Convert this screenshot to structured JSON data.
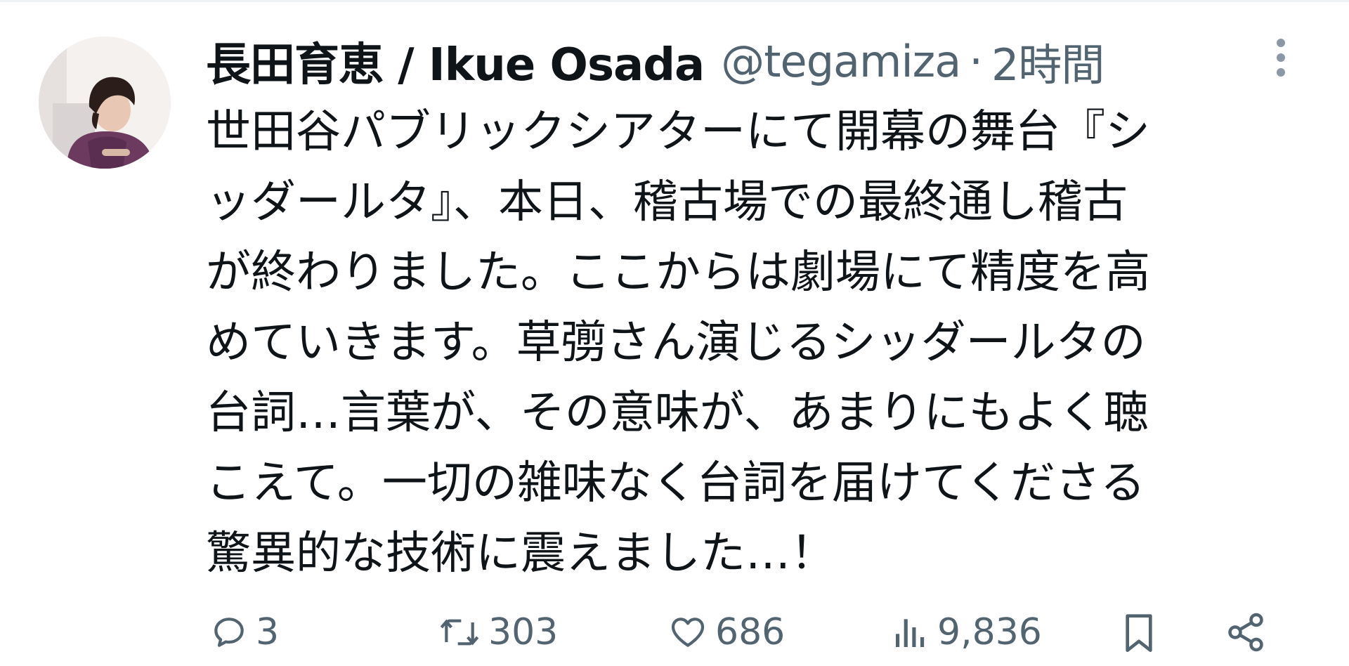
{
  "tweet": {
    "display_name": "長田育恵 / Ikue Osada",
    "handle": "@tegamiza",
    "separator": "·",
    "time": "2時間",
    "body": "世田谷パブリックシアターにて開幕の舞台『シ\nッダールタ』、本日、稽古場での最終通し稽古\nが終わりました。ここからは劇場にて精度を高\nめていきます。草彅さん演じるシッダールタの\n台詞…言葉が、その意味が、あまりにもよく聴\nこえて。一切の雑味なく台詞を届けてくださる\n驚異的な技術に震えました…！"
  },
  "actions": {
    "reply": {
      "icon": "reply-icon",
      "count": "3"
    },
    "retweet": {
      "icon": "retweet-icon",
      "count": "303"
    },
    "like": {
      "icon": "heart-icon",
      "count": "686"
    },
    "views": {
      "icon": "views-icon",
      "count": "9,836"
    },
    "bookmark": {
      "icon": "bookmark-icon"
    },
    "share": {
      "icon": "share-icon"
    }
  },
  "colors": {
    "text": "#0f1419",
    "secondary": "#536471",
    "background": "#ffffff"
  }
}
